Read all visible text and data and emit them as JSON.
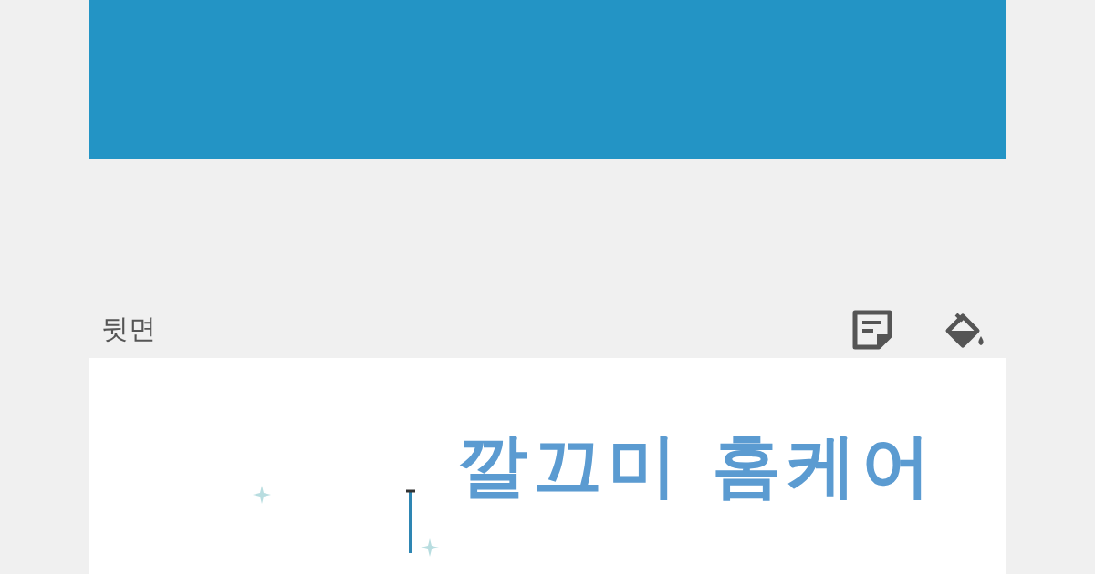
{
  "back_side": {
    "label": "뒷면",
    "card_title": "깔끄미 홈케어"
  }
}
